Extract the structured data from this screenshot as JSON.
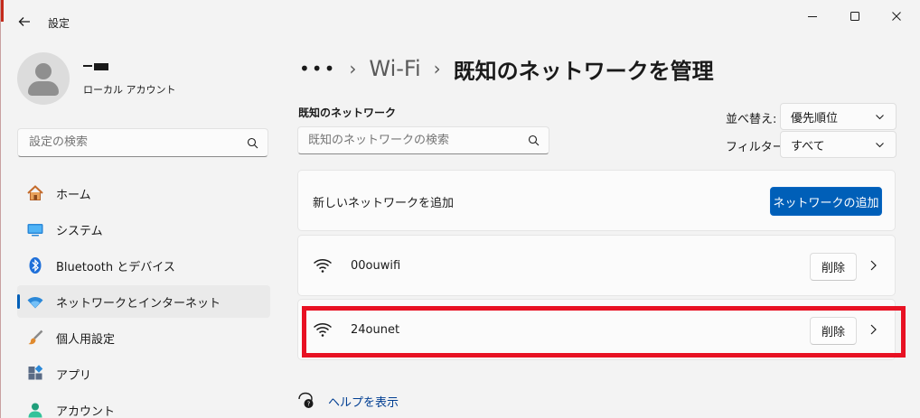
{
  "window": {
    "title": "設定"
  },
  "user": {
    "account_type": "ローカル アカウント"
  },
  "sidebar": {
    "search_placeholder": "設定の検索",
    "items": [
      {
        "label": "ホーム",
        "icon": "home-icon"
      },
      {
        "label": "システム",
        "icon": "system-icon"
      },
      {
        "label": "Bluetooth とデバイス",
        "icon": "bluetooth-icon"
      },
      {
        "label": "ネットワークとインターネット",
        "icon": "network-icon",
        "active": true
      },
      {
        "label": "個人用設定",
        "icon": "brush-icon"
      },
      {
        "label": "アプリ",
        "icon": "apps-icon"
      },
      {
        "label": "アカウント",
        "icon": "account-icon"
      }
    ]
  },
  "breadcrumb": {
    "more": "•••",
    "parent": "Wi-Fi",
    "current": "既知のネットワークを管理"
  },
  "known_networks": {
    "section_title": "既知のネットワーク",
    "search_placeholder": "既知のネットワークの検索",
    "sort": {
      "label": "並べ替え:",
      "value": "優先順位"
    },
    "filter": {
      "label": "フィルター:",
      "value": "すべて"
    },
    "add": {
      "label": "新しいネットワークを追加",
      "button": "ネットワークの追加"
    },
    "networks": [
      {
        "name": "00ouwifi",
        "delete_label": "削除"
      },
      {
        "name": "24ounet",
        "delete_label": "削除",
        "highlighted": true
      }
    ]
  },
  "help": {
    "label": "ヘルプを表示"
  },
  "colors": {
    "accent": "#005fb8",
    "highlight": "#e81123"
  }
}
